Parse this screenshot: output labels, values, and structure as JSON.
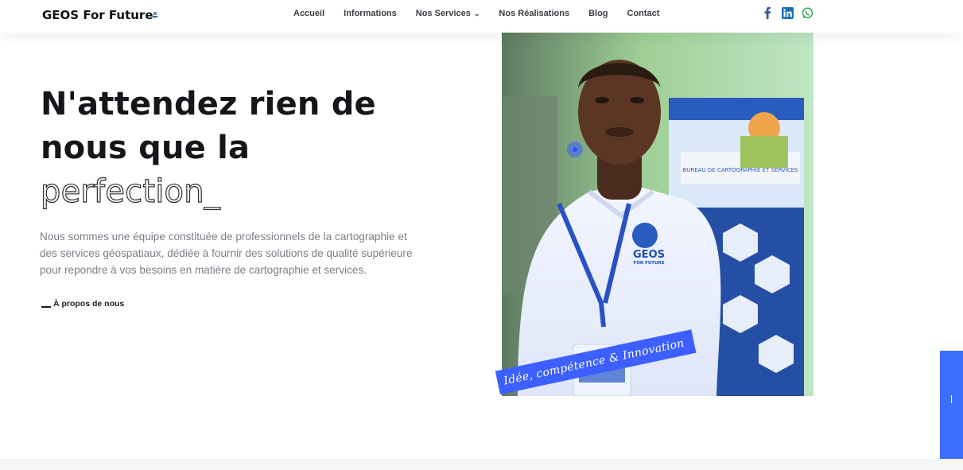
{
  "brand": {
    "name": "GEOS For Future"
  },
  "nav": {
    "items": [
      "Accueil",
      "Informations",
      "Nos Services",
      "Nos Réalisations",
      "Blog",
      "Contact"
    ]
  },
  "social": {
    "icons": [
      "facebook-icon",
      "linkedin-icon",
      "whatsapp-icon"
    ]
  },
  "hero": {
    "line1": "N'attendez rien de",
    "line2": "nous que la",
    "line3": "perfection_",
    "lead": "Nous sommes une équipe constituée de professionnels de la cartographie et des services géospatiaux, dédiée à fournir des solutions de qualité supérieure pour repondre à vos besoins en matière de cartographie et services.",
    "about_link": "À propos de nous"
  },
  "photo": {
    "shirt_brand_line1": "GEOS",
    "shirt_brand_line2": "FOR FUTURE",
    "banner_title": "BUREAU DE CARTOGRAPHIE ET SERVICES"
  },
  "tagline": "Idée, compétence & Innovation",
  "back_top": "Allez au début",
  "colors": {
    "accent": "#3d5fff",
    "back_top": "#3d6fff",
    "text_dark": "#15161a",
    "text_muted": "#7b7f87"
  }
}
